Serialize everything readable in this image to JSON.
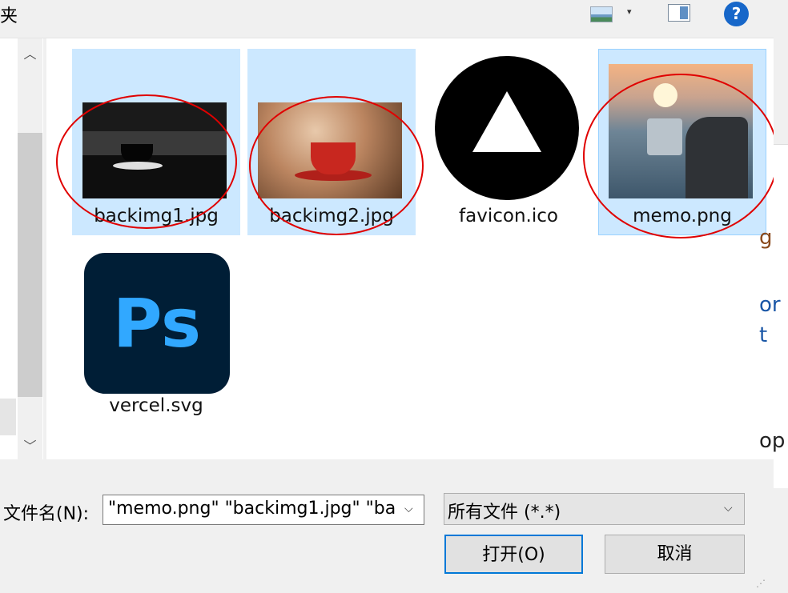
{
  "header": {
    "folder_title": "夹"
  },
  "toolbar": {
    "view_icon": "picture-view-icon",
    "view_dropdown": "▾",
    "preview_pane_icon": "preview-pane-icon",
    "help": "?"
  },
  "nav": {
    "scroll_up": "︿",
    "scroll_down": "﹀"
  },
  "files": [
    {
      "name": "backimg1.jpg",
      "selected": true
    },
    {
      "name": "backimg2.jpg",
      "selected": true
    },
    {
      "name": "favicon.ico",
      "selected": false
    },
    {
      "name": "memo.png",
      "selected": true
    },
    {
      "name": "vercel.svg",
      "selected": false,
      "icon_text": "Ps"
    }
  ],
  "background_window": {
    "partial_chars": [
      "g",
      "or",
      "t",
      "op"
    ]
  },
  "bottom": {
    "filename_label": "文件名(N):",
    "filename_value": "\"memo.png\" \"backimg1.jpg\" \"ba",
    "filetype_value": "所有文件 (*.*)",
    "open_button": "打开(O)",
    "cancel_button": "取消"
  },
  "colors": {
    "selection": "#cce8ff",
    "accent": "#0078d7",
    "annotation": "#e00000",
    "help": "#1767c9"
  }
}
